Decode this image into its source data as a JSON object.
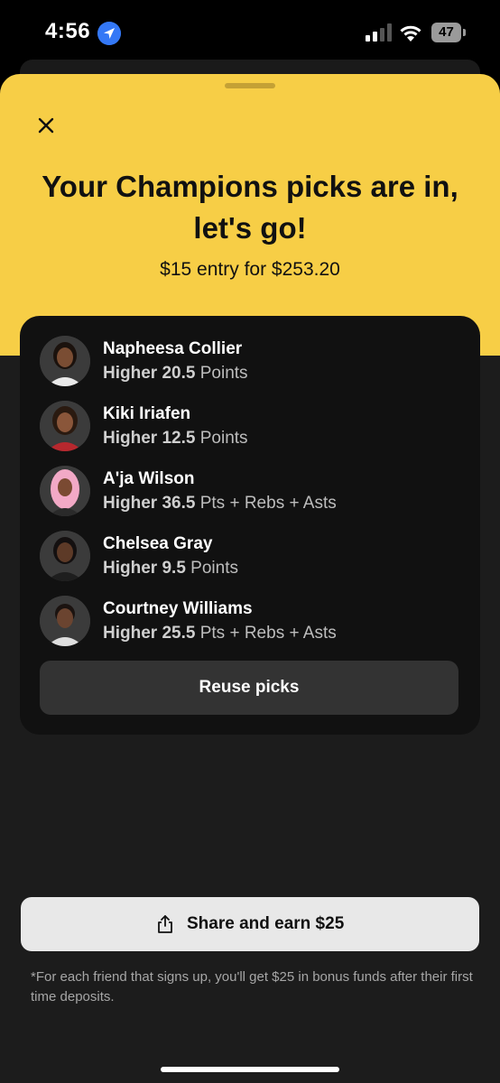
{
  "status": {
    "time": "4:56",
    "battery": "47"
  },
  "sheet": {
    "title_line1": "Your Champions picks are in,",
    "title_line2": "let's go!",
    "subtitle": "$15 entry for $253.20"
  },
  "picks": [
    {
      "name": "Napheesa Collier",
      "direction": "Higher",
      "line": "20.5",
      "stat": "Points"
    },
    {
      "name": "Kiki Iriafen",
      "direction": "Higher",
      "line": "12.5",
      "stat": "Points"
    },
    {
      "name": "A'ja Wilson",
      "direction": "Higher",
      "line": "36.5",
      "stat": "Pts + Rebs + Asts"
    },
    {
      "name": "Chelsea Gray",
      "direction": "Higher",
      "line": "9.5",
      "stat": "Points"
    },
    {
      "name": "Courtney Williams",
      "direction": "Higher",
      "line": "25.5",
      "stat": "Pts + Rebs + Asts"
    }
  ],
  "buttons": {
    "reuse": "Reuse picks",
    "share": "Share and earn $25"
  },
  "disclaimer": "*For each friend that signs up, you'll get $25 in bonus funds after their first time deposits.",
  "colors": {
    "accent": "#f7ce46",
    "background": "#1c1c1c",
    "card": "#111111"
  },
  "icons": {
    "close": "close-icon",
    "share": "share-icon",
    "location": "location-arrow-icon"
  }
}
